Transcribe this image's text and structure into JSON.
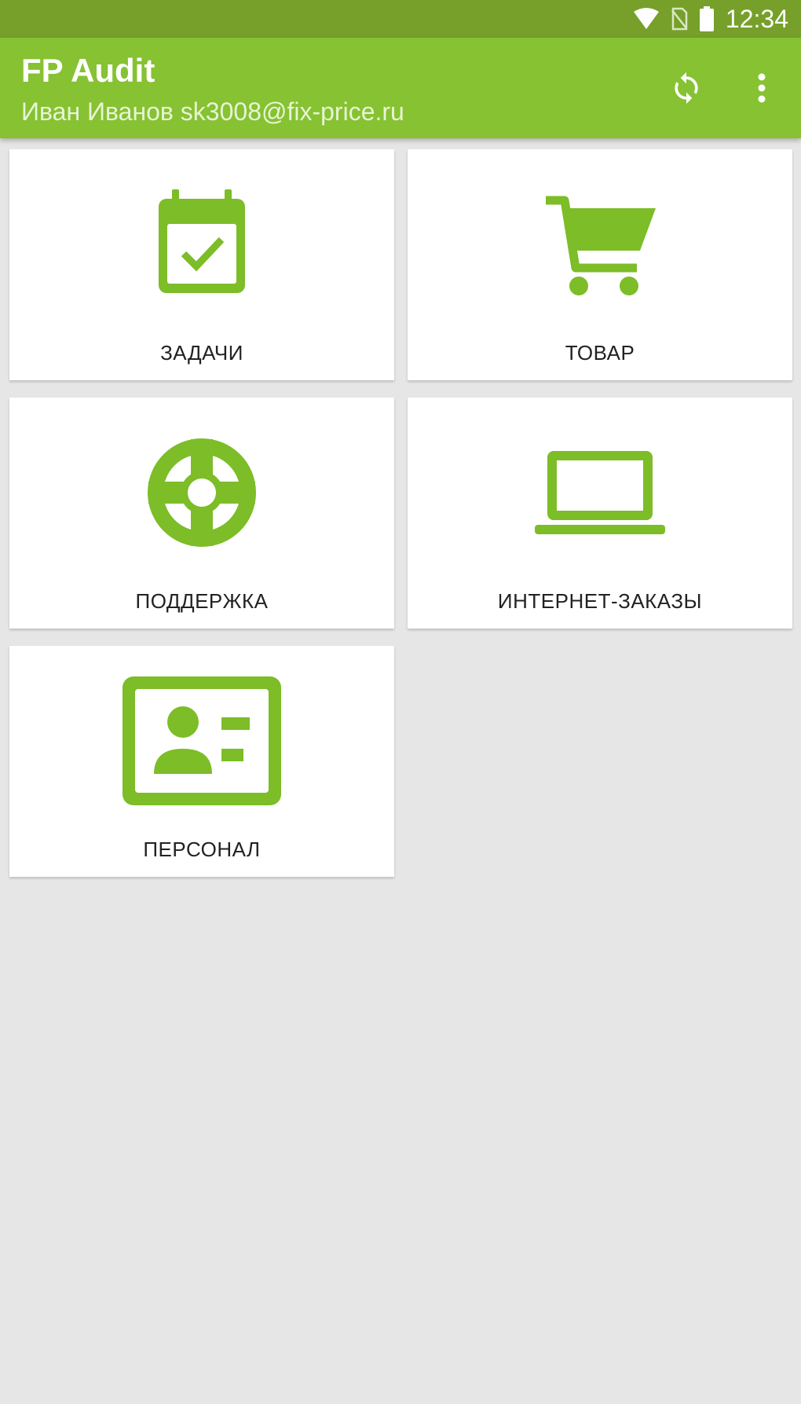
{
  "status_bar": {
    "time": "12:34",
    "icons": [
      "wifi-icon",
      "no-sim-icon",
      "battery-icon"
    ]
  },
  "app_bar": {
    "title": "FP Audit",
    "subtitle": "Иван Иванов sk3008@fix-price.ru",
    "actions": [
      "sync-icon",
      "more-vert-icon"
    ]
  },
  "tiles": [
    {
      "label": "ЗАДАЧИ",
      "icon": "calendar-check-icon"
    },
    {
      "label": "ТОВАР",
      "icon": "shopping-cart-icon"
    },
    {
      "label": "ПОДДЕРЖКА",
      "icon": "lifebuoy-icon"
    },
    {
      "label": "ИНТЕРНЕТ-ЗАКАЗЫ",
      "icon": "laptop-icon"
    },
    {
      "label": "ПЕРСОНАЛ",
      "icon": "id-card-icon"
    }
  ],
  "colors": {
    "status_bar": "#76a02a",
    "app_bar": "#86c232",
    "accent": "#7cbd28",
    "background": "#e6e6e6",
    "tile": "#ffffff"
  }
}
